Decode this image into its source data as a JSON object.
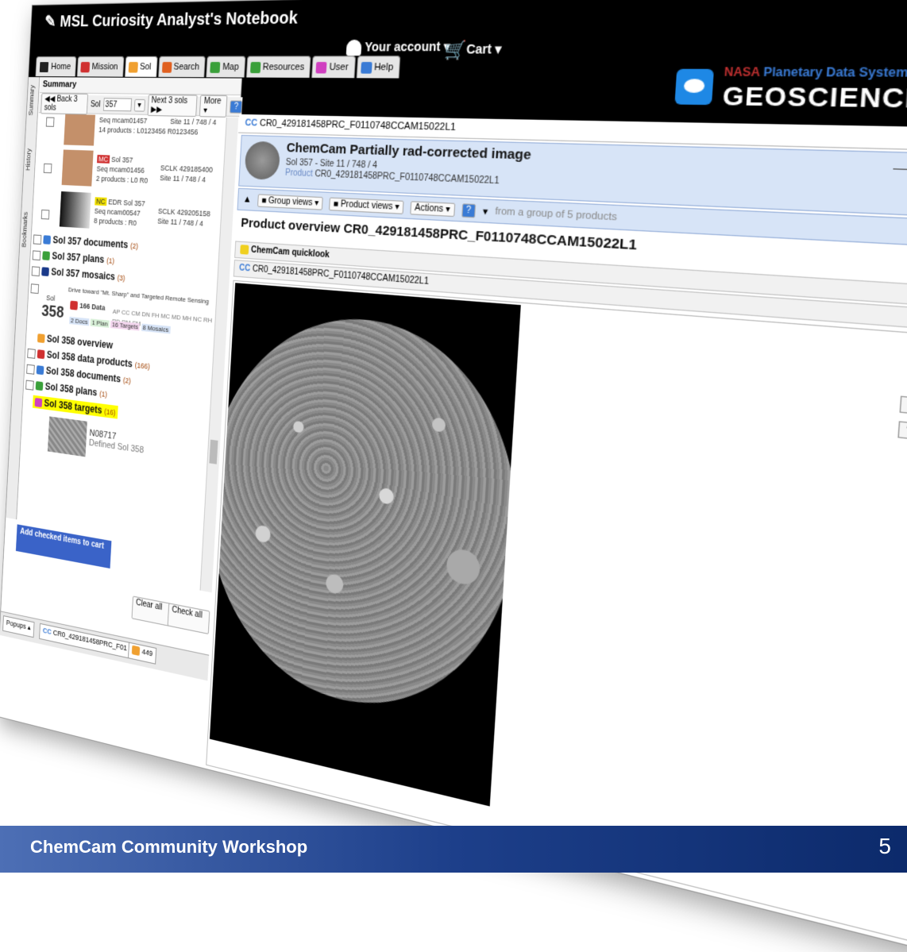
{
  "app": {
    "title": "MSL Curiosity Analyst's Notebook",
    "account_label": "Your account",
    "cart_label": "Cart",
    "brand_nasa": "NASA",
    "brand_pds": "Planetary Data System",
    "brand_geo": "GEOSCIENCES"
  },
  "tabs": [
    {
      "label": "Home",
      "color": "#222222"
    },
    {
      "label": "Mission",
      "color": "#d03030"
    },
    {
      "label": "Sol",
      "color": "#f0a030"
    },
    {
      "label": "Search",
      "color": "#e06020"
    },
    {
      "label": "Map",
      "color": "#3aa03a"
    },
    {
      "label": "Resources",
      "color": "#3aa03a"
    },
    {
      "label": "User",
      "color": "#d040c0"
    },
    {
      "label": "Help",
      "color": "#3a7bd5"
    }
  ],
  "left": {
    "summary_label": "Summary",
    "vtabs": [
      "Summary",
      "History",
      "Bookmarks"
    ],
    "back_label": "Back 3 sols",
    "sol_label": "Sol",
    "sol_value": "357",
    "next_label": "Next 3 sols",
    "more_label": "More",
    "items": [
      {
        "seq": "Seq mcam01457",
        "products": "14 products : L0123456 R0123456",
        "site": "Site 11 / 748 / 4"
      },
      {
        "badge": "MC",
        "sol": "Sol 357",
        "seq": "Seq mcam01456",
        "sclk": "SCLK 429185400",
        "products": "2 products : L0 R0",
        "site": "Site 11 / 748 / 4"
      },
      {
        "badge": "NC",
        "type": "EDR",
        "sol": "Sol 357",
        "seq": "Seq ncam00547",
        "sclk": "SCLK 429205158",
        "products": "8 products : R0",
        "site": "Site 11 / 748 / 4"
      }
    ],
    "groups357": [
      {
        "label": "Sol 357 documents",
        "count": "(2)"
      },
      {
        "label": "Sol 357 plans",
        "count": "(1)"
      },
      {
        "label": "Sol 357 mosaics",
        "count": "(3)"
      }
    ],
    "sol358": {
      "sol_word": "Sol",
      "sol_num": "358",
      "drive": "Drive toward \"Mt. Sharp\" and Targeted Remote Sensing",
      "data": "166 Data",
      "docs": "2 Docs",
      "plan": "1 Plan",
      "targets": "16 Targets",
      "mosaics": "8 Mosaics",
      "instruments": "AP CC CM DN FH MC MD MH NC RH RD RM SM"
    },
    "groups358": [
      {
        "label": "Sol 358 overview",
        "count": ""
      },
      {
        "label": "Sol 358 data products",
        "count": "(166)"
      },
      {
        "label": "Sol 358 documents",
        "count": "(2)"
      },
      {
        "label": "Sol 358 plans",
        "count": "(1)"
      },
      {
        "label": "Sol 358 targets",
        "count": "(16)"
      }
    ],
    "target": {
      "name": "N08717",
      "defined": "Defined Sol 358"
    },
    "add_cart_label": "Add checked items to cart",
    "clear_label": "Clear all",
    "check_label": "Check all",
    "popups_label": "Popups",
    "popup_tabs": [
      "CR0_429181458PRC_F01",
      "449"
    ]
  },
  "right": {
    "doc_tab": "CR0_429181458PRC_F0110748CCAM15022L1",
    "product_title": "ChemCam Partially rad-corrected image",
    "product_sub": "Sol 357 - Site 11 / 748 / 4",
    "product_label": "Product",
    "product_id": "CR0_429181458PRC_F0110748CCAM15022L1",
    "group_views": "Group views",
    "product_views": "Product views",
    "actions": "Actions",
    "group_note": "from a group of 5 products",
    "overview": "Product overview CR0_429181458PRC_F0110748CCAM15022L1",
    "quicklook": "ChemCam quicklook",
    "cc_row": "CR0_429181458PRC_F0110748CCAM15022L1"
  },
  "footer": {
    "title": "ChemCam Community Workshop",
    "page": "5"
  }
}
